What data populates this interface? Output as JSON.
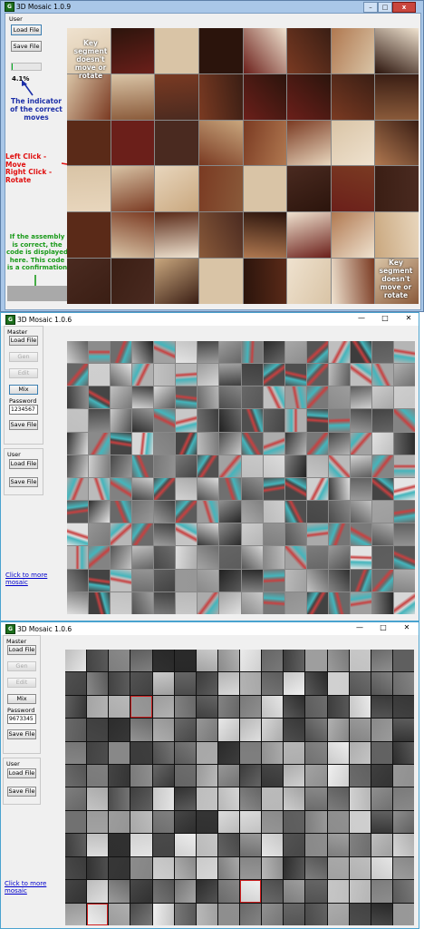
{
  "window1": {
    "title": "3D Mosaic 1.0.9",
    "controls": {
      "minimize": "–",
      "maximize": "□",
      "close": "x"
    },
    "group_label": "User",
    "load_label": "Load File",
    "save_label": "Save File",
    "progress_fraction": 0.041,
    "percent_text": "4.1%",
    "indicator_note": "The indicator of the correct moves",
    "left_click_text": "Left Click - Move",
    "right_click_text": "Right Click - Rotate",
    "assembly_note": "If the assembly is correct, the code is displayed here. This code is a confirmation",
    "key_segment_top": "Key segment doesn't move or rotate",
    "key_segment_bottom": "Key segment doesn't move or rotate",
    "colors": {
      "note_blue": "#1c2fa8",
      "note_red": "#e01010",
      "note_green": "#1a9a1a",
      "progress": "#06b025"
    }
  },
  "window2": {
    "title": "3D Mosaic 1.0.6",
    "controls": {
      "minimize": "—",
      "maximize": "□",
      "close": "✕"
    },
    "master_label": "Master",
    "load_label": "Load File",
    "gen_label": "Gen",
    "edit_label": "Edit",
    "mix_label": "Mix",
    "password_label": "Password",
    "password_value": "1234567",
    "save_label": "Save File",
    "user_label": "User",
    "user_load_label": "Load File",
    "user_save_label": "Save File",
    "link_text": "Click to more mosaic"
  },
  "window3": {
    "title": "3D Mosaic 1.0.6",
    "controls": {
      "minimize": "—",
      "maximize": "□",
      "close": "✕"
    },
    "master_label": "Master",
    "load_label": "Load File",
    "gen_label": "Gen",
    "edit_label": "Edit",
    "mix_label": "Mix",
    "password_label": "Password",
    "password_value": "9673345",
    "save_label": "Save File",
    "user_label": "User",
    "user_load_label": "Load File",
    "user_save_label": "Save File",
    "link_text": "Click to more mosaic"
  }
}
